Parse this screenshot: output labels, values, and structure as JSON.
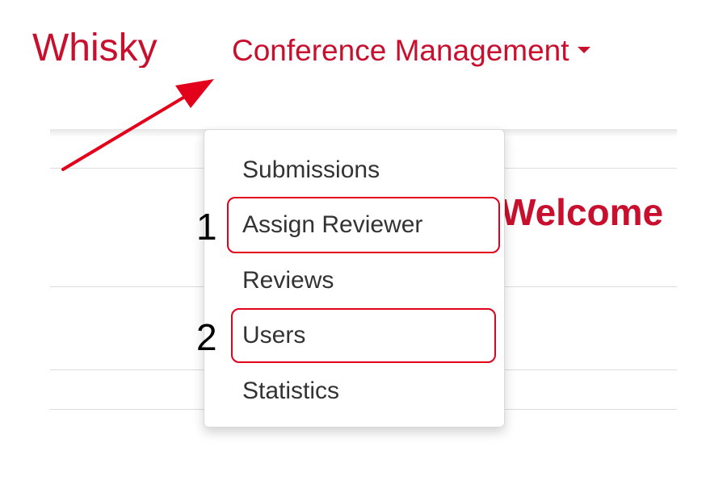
{
  "header": {
    "brand": "Whisky",
    "nav_dropdown": {
      "label": "Conference Management",
      "icon": "caret-down-icon"
    }
  },
  "dropdown_menu": {
    "items": [
      {
        "label": "Submissions"
      },
      {
        "label": "Assign Reviewer"
      },
      {
        "label": "Reviews"
      },
      {
        "label": "Users"
      },
      {
        "label": "Statistics"
      }
    ]
  },
  "main": {
    "heading": "Welcome"
  },
  "annotations": {
    "step_labels": [
      "1",
      "2"
    ],
    "highlight_color": "#e2001a",
    "arrow_color": "#e2001a",
    "arrow_icon": "arrow-pointer-icon"
  },
  "colors": {
    "accent": "#c8102e",
    "menu_text": "#333333"
  }
}
